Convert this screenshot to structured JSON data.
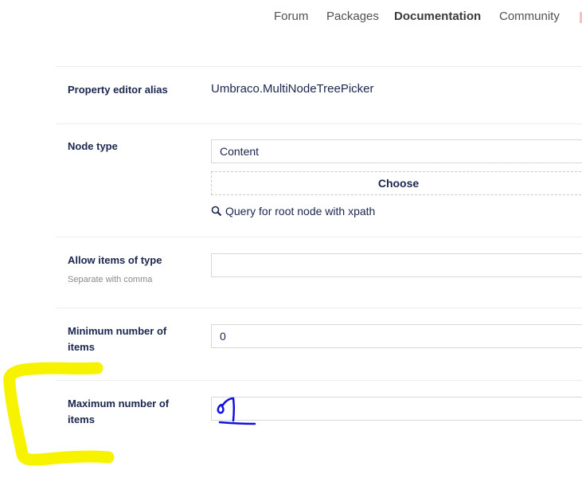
{
  "nav": {
    "items": [
      {
        "label": "Forum"
      },
      {
        "label": "Packages"
      },
      {
        "label": "Documentation"
      },
      {
        "label": "Community"
      }
    ]
  },
  "form": {
    "alias": {
      "label": "Property editor alias",
      "value": "Umbraco.MultiNodeTreePicker"
    },
    "node_type": {
      "label": "Node type",
      "value": "Content",
      "choose_label": "Choose",
      "query_label": "Query for root node with xpath"
    },
    "allow_items": {
      "label": "Allow items of type",
      "description": "Separate with comma",
      "value": ""
    },
    "min_items": {
      "label": "Minimum number of items",
      "value": "0"
    },
    "max_items": {
      "label": "Maximum number of items",
      "value": ""
    }
  },
  "colors": {
    "text": "#1b264f",
    "highlighter": "#f7f300",
    "pen": "#1111dd"
  },
  "annotations": {
    "highlight": "yellow-bracket-highlight",
    "handwriting": "handwritten-digit-1"
  }
}
